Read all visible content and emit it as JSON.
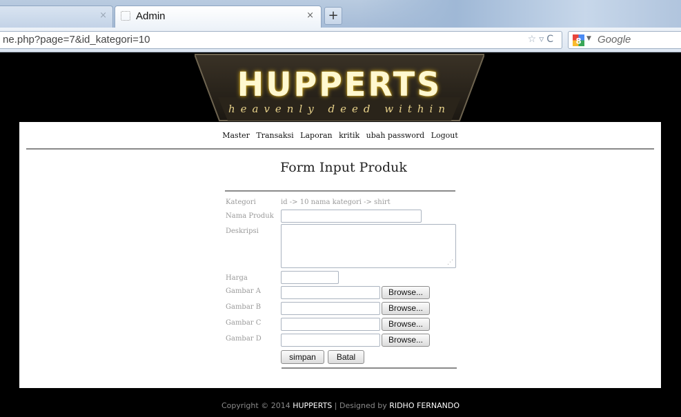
{
  "browser": {
    "prev_tab_close": "×",
    "active_tab": {
      "title": "Admin",
      "close": "×"
    },
    "new_tab": "+",
    "url": "ne.php?page=7&id_kategori=10",
    "search_engine": "Google"
  },
  "banner": {
    "logo_word": "HUPPERTS",
    "logo_tagline": "heavenly deed within"
  },
  "menu": {
    "items": [
      "Master",
      "Transaksi",
      "Laporan",
      "kritik",
      "ubah password",
      "Logout"
    ]
  },
  "form": {
    "title": "Form Input Produk",
    "kategori_label": "Kategori",
    "kategori_value": "id -> 10 nama kategori -> shirt",
    "nama_produk_label": "Nama Produk",
    "nama_produk_value": "",
    "deskripsi_label": "Deskripsi",
    "deskripsi_value": "",
    "harga_label": "Harga",
    "harga_value": "",
    "gambar_labels": [
      "Gambar A",
      "Gambar B",
      "Gambar C",
      "Gambar D"
    ],
    "browse_label": "Browse...",
    "simpan_label": "simpan",
    "batal_label": "Batal"
  },
  "footer": {
    "prefix": "Copyright © 2014 ",
    "brand": "HUPPERTS",
    "middle": " | Designed by ",
    "author": "RIDHO FERNANDO"
  }
}
